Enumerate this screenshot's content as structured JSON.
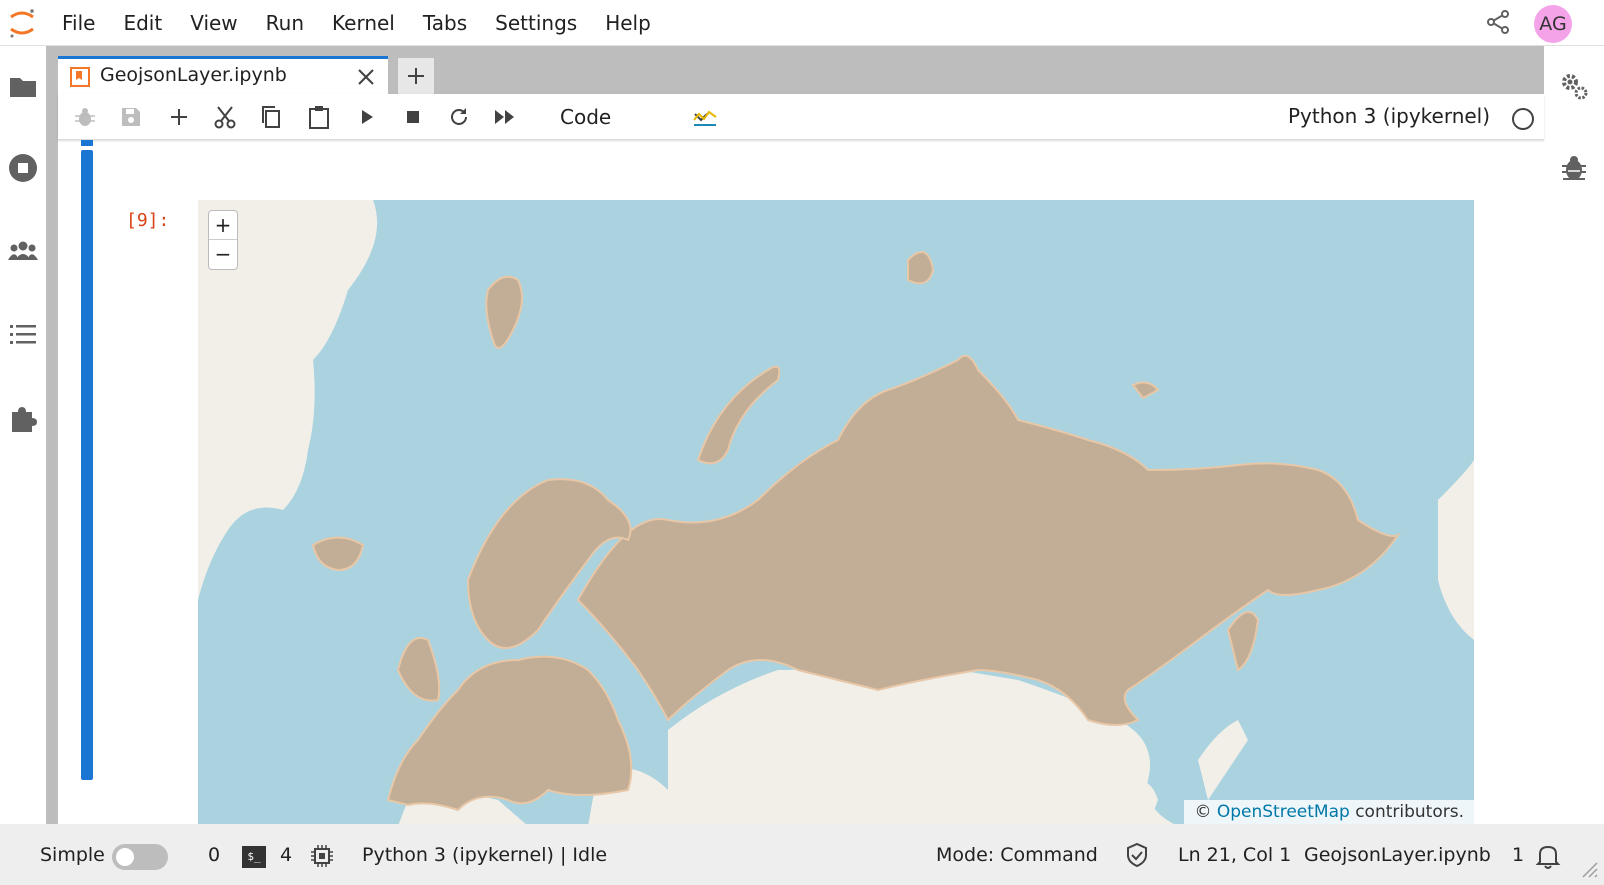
{
  "menu": {
    "items": [
      "File",
      "Edit",
      "View",
      "Run",
      "Kernel",
      "Tabs",
      "Settings",
      "Help"
    ]
  },
  "user": {
    "initials": "AG",
    "avatar_color": "#f4a3e8"
  },
  "left_sidebar": {
    "icons": [
      "folder-icon",
      "running-icon",
      "collaborators-icon",
      "toc-icon",
      "extension-icon"
    ]
  },
  "right_sidebar": {
    "icons": [
      "property-inspector-icon",
      "debugger-icon"
    ]
  },
  "tab": {
    "label": "GeojsonLayer.ipynb",
    "icon": "notebook-icon"
  },
  "toolbar": {
    "icons": [
      "bug-icon",
      "save-icon",
      "add-cell-icon",
      "cut-icon",
      "copy-icon",
      "paste-icon",
      "run-icon",
      "stop-icon",
      "restart-icon",
      "run-all-icon",
      "trace-icon"
    ],
    "cell_type": "Code",
    "kernel_name": "Python 3 (ipykernel)"
  },
  "cell": {
    "prompt": "[9]:",
    "map": {
      "zoom_in": "+",
      "zoom_out": "−",
      "attribution_prefix": "©",
      "attribution_link": "OpenStreetMap",
      "attribution_suffix": "contributors."
    }
  },
  "status": {
    "simple_label": "Simple",
    "simple_enabled": false,
    "terminals": "0",
    "kernels": "4",
    "kernel_status": "Python 3 (ipykernel) | Idle",
    "mode": "Mode: Command",
    "cursor": "Ln 21, Col 1",
    "filename": "GeojsonLayer.ipynb",
    "notifications": "1"
  },
  "colors": {
    "accent": "#1976d2",
    "prompt": "#d84315",
    "water": "#aad3df",
    "land": "#f2efe9",
    "geojson_fill": "#c2ad96",
    "geojson_stroke": "#e8c7a7"
  }
}
